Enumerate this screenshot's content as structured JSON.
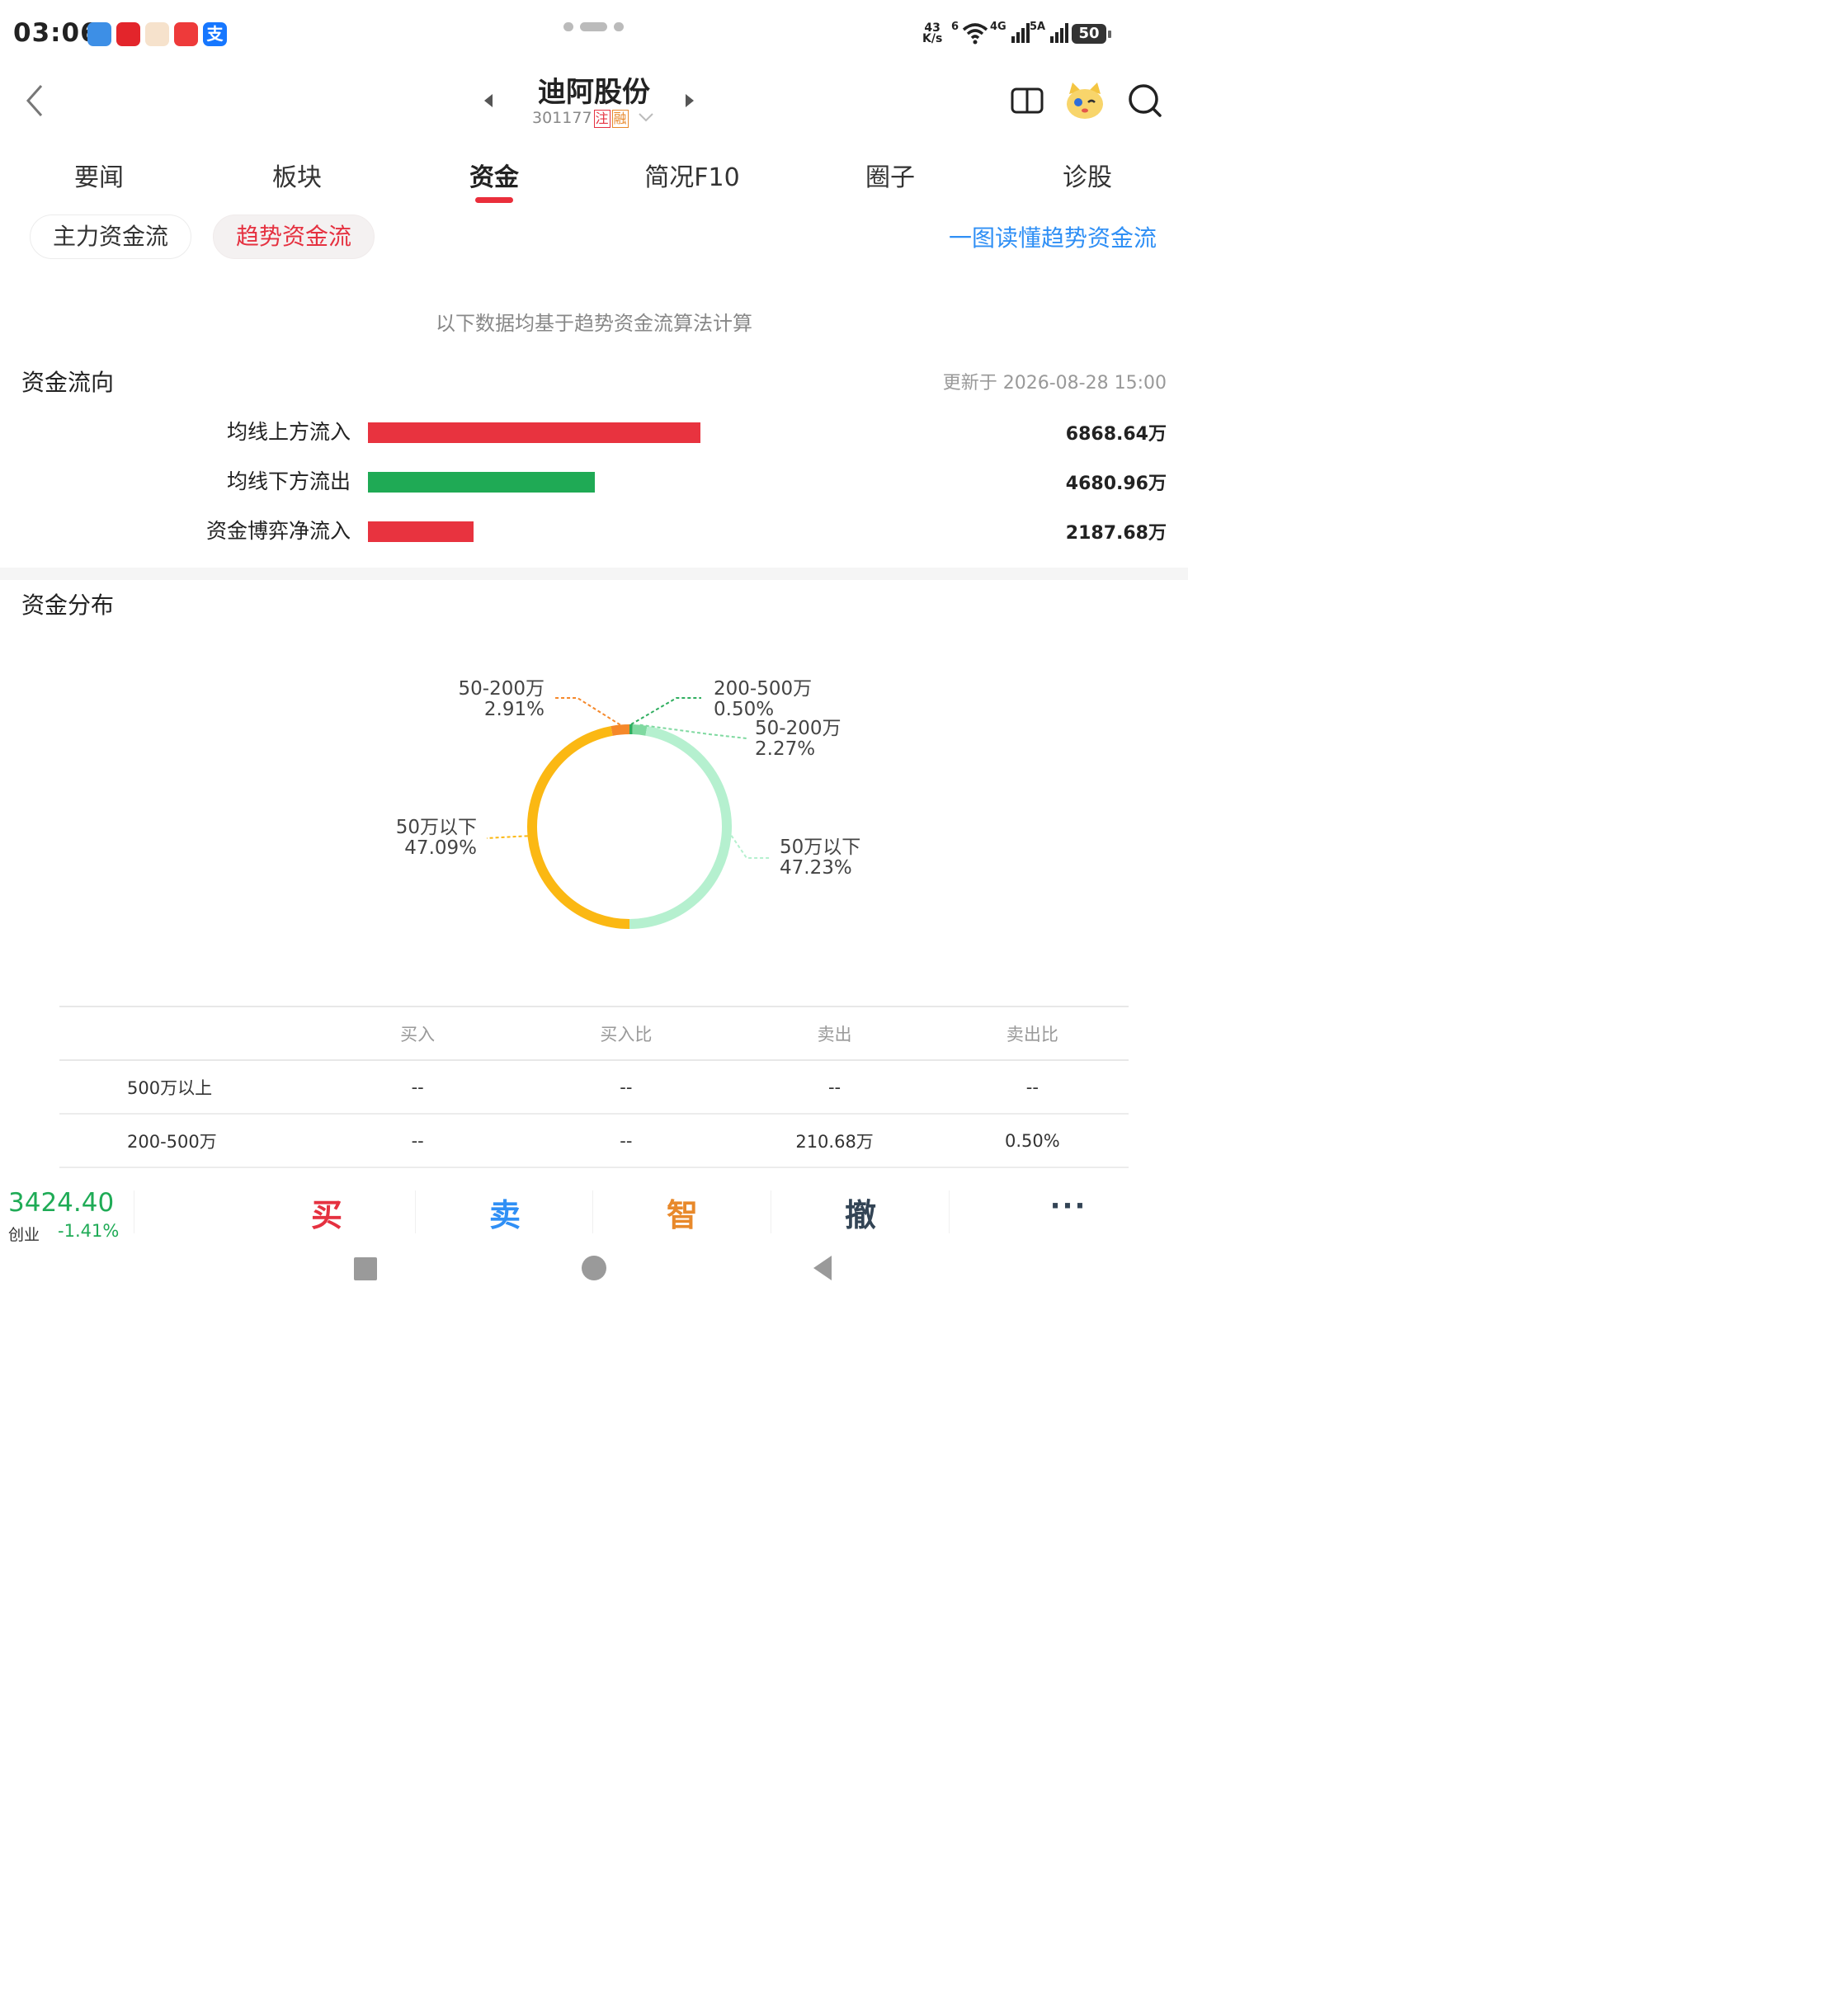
{
  "status_bar": {
    "time": "03:06",
    "net_speed_value": "43",
    "net_speed_unit": "K/s",
    "wifi_label": "6",
    "signal1_label": "4G",
    "signal2_label": "5A",
    "battery": "50"
  },
  "header": {
    "stock_name": "迪阿股份",
    "stock_code": "301177",
    "tag1": "注",
    "tag2": "融"
  },
  "tabs": [
    {
      "label": "要闻"
    },
    {
      "label": "板块"
    },
    {
      "label": "资金"
    },
    {
      "label": "简况F10"
    },
    {
      "label": "圈子"
    },
    {
      "label": "诊股"
    }
  ],
  "subtabs": {
    "main": "主力资金流",
    "trend": "趋势资金流",
    "explain_link": "一图读懂趋势资金流"
  },
  "note": "以下数据均基于趋势资金流算法计算",
  "flow_section": {
    "title": "资金流向",
    "updated": "更新于 2026-08-28 15:00",
    "rows": [
      {
        "label": "均线上方流入",
        "value_text": "6868.64万",
        "value": 6868.64,
        "color": "#e8333f"
      },
      {
        "label": "均线下方流出",
        "value_text": "4680.96万",
        "value": 4680.96,
        "color": "#1faa55"
      },
      {
        "label": "资金博弈净流入",
        "value_text": "2187.68万",
        "value": 2187.68,
        "color": "#e8333f"
      }
    ]
  },
  "distribution_section": {
    "title": "资金分布"
  },
  "chart_data": {
    "type": "pie",
    "slices": [
      {
        "category": "200-500万",
        "percent": 0.5,
        "label_pct": "0.50%",
        "color": "#2fae5f",
        "side": "sell"
      },
      {
        "category": "50-200万",
        "percent": 2.27,
        "label_pct": "2.27%",
        "color": "#7fd9a0",
        "side": "sell"
      },
      {
        "category": "50万以下",
        "percent": 47.23,
        "label_pct": "47.23%",
        "color": "#b5f0cf",
        "side": "sell"
      },
      {
        "category": "50万以下",
        "percent": 47.09,
        "label_pct": "47.09%",
        "color": "#fbb813",
        "side": "buy"
      },
      {
        "category": "50-200万",
        "percent": 2.91,
        "label_pct": "2.91%",
        "color": "#f5882a",
        "side": "buy"
      }
    ]
  },
  "table": {
    "headers": [
      "",
      "买入",
      "买入比",
      "卖出",
      "卖出比"
    ],
    "rows": [
      [
        "500万以上",
        "--",
        "--",
        "--",
        "--"
      ],
      [
        "200-500万",
        "--",
        "--",
        "210.68万",
        "0.50%"
      ]
    ]
  },
  "bottom_bar": {
    "index_value": "3424.40",
    "index_name": "创业",
    "index_change": "-1.41%",
    "buy": "买",
    "sell": "卖",
    "smart": "智",
    "cancel": "撤",
    "more": "···"
  },
  "colors": {
    "accent_red": "#ea2e3b",
    "link_blue": "#2f8ff5",
    "green": "#1faa55",
    "orange": "#e8892b",
    "cancel_gray": "#334455"
  }
}
